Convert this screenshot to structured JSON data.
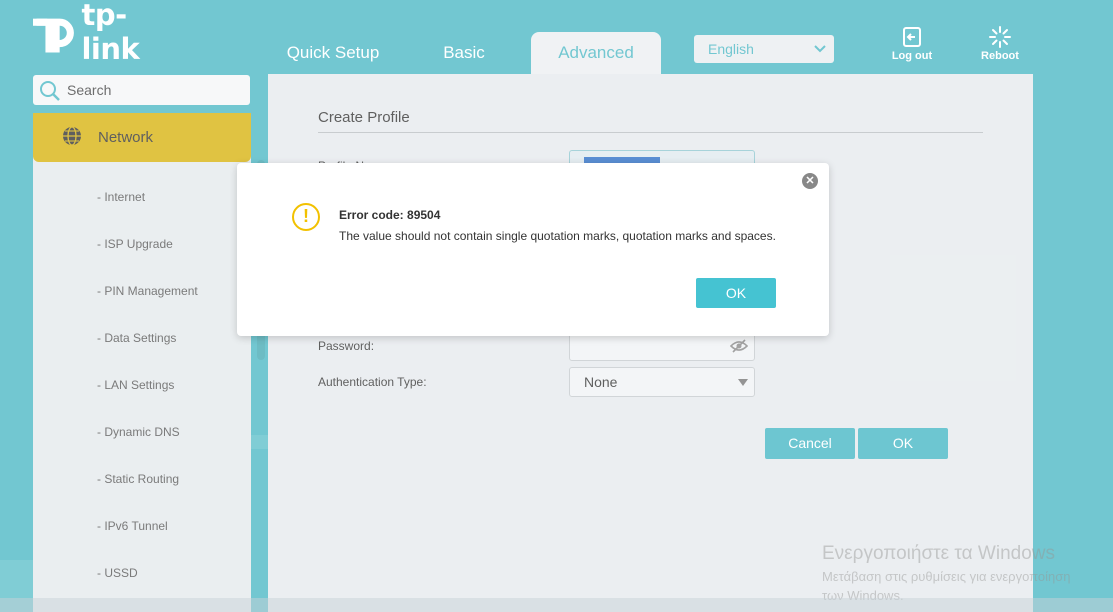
{
  "brand": {
    "logo_text": "tp-link"
  },
  "nav": {
    "tabs": [
      {
        "label": "Quick Setup"
      },
      {
        "label": "Basic"
      },
      {
        "label": "Advanced",
        "active": true
      }
    ]
  },
  "header": {
    "language": "English",
    "logout_label": "Log out",
    "reboot_label": "Reboot"
  },
  "search": {
    "placeholder": "Search"
  },
  "sidebar": {
    "active_section": "Network",
    "items": [
      {
        "label": "- Internet"
      },
      {
        "label": "- ISP Upgrade"
      },
      {
        "label": "- PIN Management"
      },
      {
        "label": "- Data Settings"
      },
      {
        "label": "- LAN Settings"
      },
      {
        "label": "- Dynamic DNS"
      },
      {
        "label": "- Static Routing"
      },
      {
        "label": "- IPv6 Tunnel"
      },
      {
        "label": "- USSD"
      }
    ]
  },
  "form": {
    "title": "Create Profile",
    "profile_name_label": "Profile Name:",
    "password_label": "Password:",
    "auth_type_label": "Authentication Type:",
    "auth_type_value": "None",
    "cancel_label": "Cancel",
    "ok_label": "OK"
  },
  "dialog": {
    "title": "Error code: 89504",
    "message": "The value should not contain single quotation marks, quotation marks and spaces.",
    "ok_label": "OK"
  },
  "watermark": {
    "line1": "Ενεργοποιήστε τα Windows",
    "line2": "Μετάβαση στις ρυθμίσεις για ενεργοποίηση",
    "line3": "των Windows."
  },
  "colors": {
    "accent": "#4bb8c4",
    "active_nav": "#d8b20e",
    "warning": "#f2c100"
  }
}
